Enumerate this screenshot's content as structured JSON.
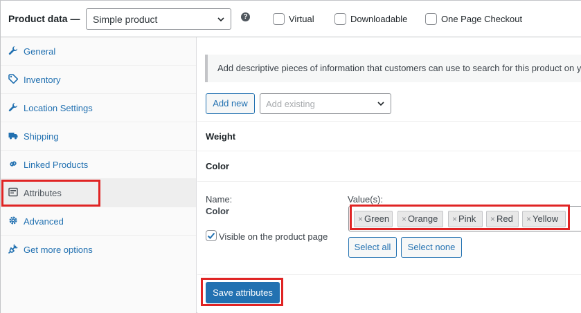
{
  "header": {
    "title": "Product data —",
    "product_type": "Simple product",
    "help_glyph": "?",
    "checkboxes": [
      {
        "label": "Virtual",
        "checked": false
      },
      {
        "label": "Downloadable",
        "checked": false
      },
      {
        "label": "One Page Checkout",
        "checked": false
      }
    ]
  },
  "sidebar": {
    "items": [
      {
        "label": "General",
        "icon": "wrench-icon"
      },
      {
        "label": "Inventory",
        "icon": "tag-icon"
      },
      {
        "label": "Location Settings",
        "icon": "wrench-icon"
      },
      {
        "label": "Shipping",
        "icon": "truck-icon"
      },
      {
        "label": "Linked Products",
        "icon": "link-icon"
      },
      {
        "label": "Attributes",
        "icon": "list-icon",
        "active": true
      },
      {
        "label": "Advanced",
        "icon": "gear-icon"
      },
      {
        "label": "Get more options",
        "icon": "plug-icon"
      }
    ]
  },
  "main": {
    "notice": "Add descriptive pieces of information that customers can use to search for this product on y",
    "add_new": "Add new",
    "add_existing_placeholder": "Add existing",
    "attributes": [
      {
        "title": "Weight"
      },
      {
        "title": "Color"
      }
    ],
    "detail": {
      "name_label": "Name:",
      "name_value": "Color",
      "values_label": "Value(s):",
      "chip_remove": "×",
      "values": [
        "Green",
        "Orange",
        "Pink",
        "Red",
        "Yellow"
      ],
      "visible_label": "Visible on the product page",
      "visible_checked": true,
      "select_all": "Select all",
      "select_none": "Select none"
    },
    "save_button": "Save attributes"
  },
  "colors": {
    "accent": "#2271b1",
    "highlight": "#e02424"
  }
}
